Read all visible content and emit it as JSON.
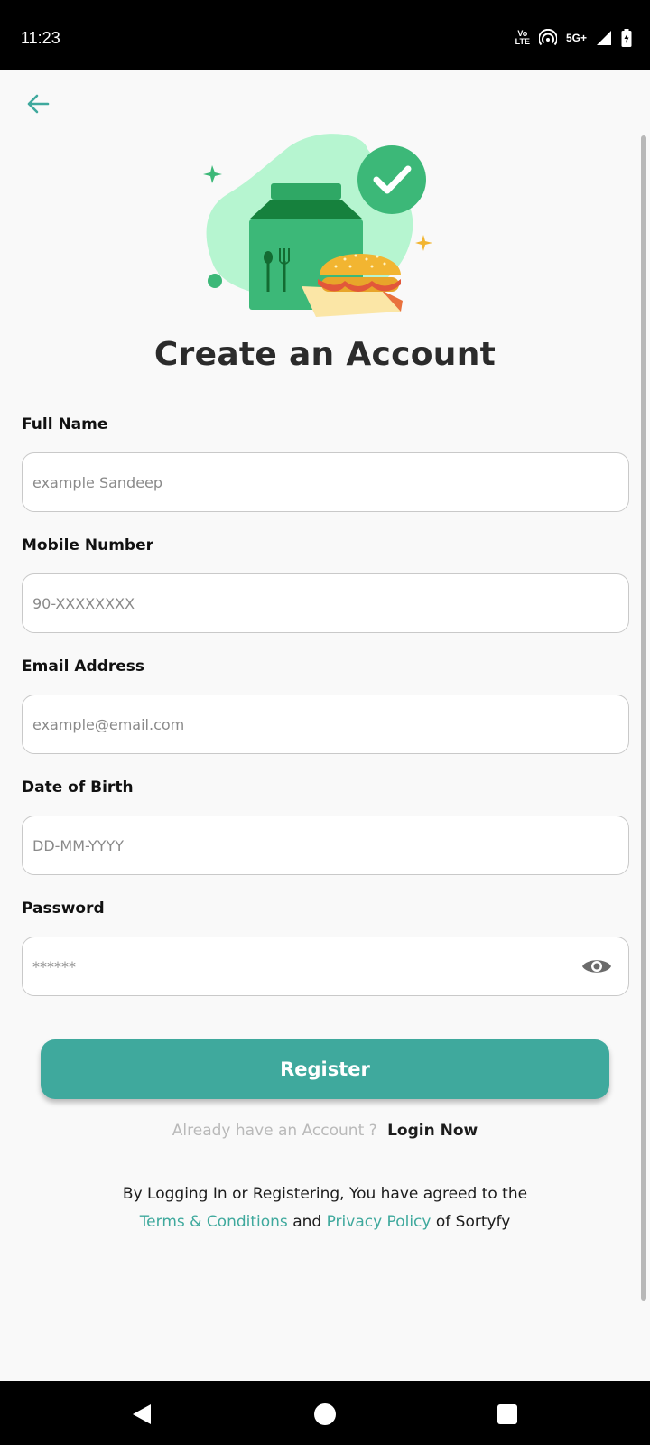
{
  "status_bar": {
    "time": "11:23",
    "volte_top": "Vo",
    "volte_bottom": "LTE",
    "network": "5G+"
  },
  "header": {
    "back_icon": "arrow-left-icon"
  },
  "title": "Create an Account",
  "form": {
    "full_name": {
      "label": "Full Name",
      "placeholder": "example Sandeep",
      "value": ""
    },
    "mobile": {
      "label": "Mobile Number",
      "placeholder": "90-XXXXXXXX",
      "value": ""
    },
    "email": {
      "label": "Email Address",
      "placeholder": "example@email.com",
      "value": ""
    },
    "dob": {
      "label": "Date of Birth",
      "placeholder": "DD-MM-YYYY",
      "value": ""
    },
    "password": {
      "label": "Password",
      "placeholder": "******",
      "value": "",
      "toggle_icon": "eye-icon"
    }
  },
  "register_label": "Register",
  "login": {
    "prompt": "Already have an Account ?",
    "link": "Login Now"
  },
  "terms": {
    "line1": "By Logging In or Registering, You have agreed to the",
    "terms_link": "Terms & Conditions",
    "and": "and",
    "privacy_link": "Privacy Policy",
    "suffix": "of Sortyfy"
  },
  "colors": {
    "accent": "#3fa99d",
    "title": "#2b2b2b",
    "placeholder": "#8a8a8a",
    "hero_blob": "#b6f5d0",
    "hero_bag": "#3cb878",
    "hero_burger_bun": "#f2b531"
  }
}
